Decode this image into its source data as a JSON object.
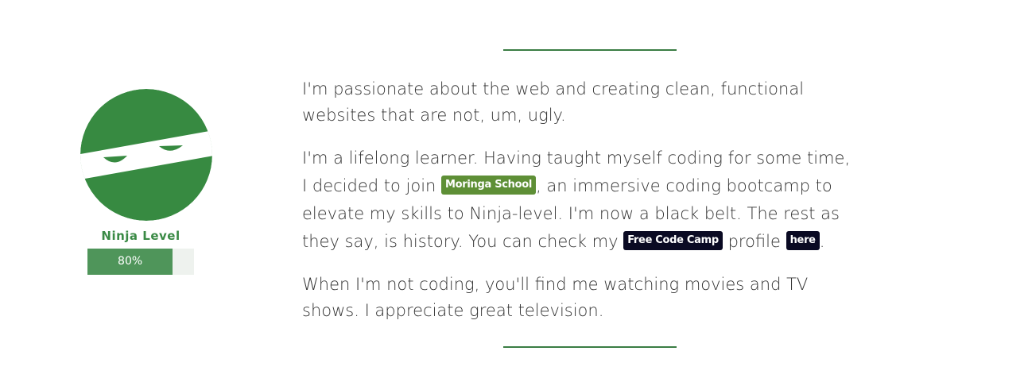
{
  "dividers": {
    "color": "#3a7d44"
  },
  "skill": {
    "icon": "ninja-icon",
    "label": "Ninja Level",
    "progress_text": "80%",
    "progress_value": 0.8,
    "color": "#3a8a45"
  },
  "about": {
    "p1": "I'm passionate about the web and creating clean, functional websites that are not, um, ugly.",
    "p2": {
      "before_school": "I'm a lifelong learner. Having taught myself coding for some time, I decided to join ",
      "school_link": "Moringa School",
      "after_school": ", an immersive coding bootcamp to elevate my skills to Ninja-level. I'm now a black belt. The rest as they say, is history. You can check my ",
      "fcc_link": "Free Code Camp",
      "middle": " profile ",
      "here_link": "here",
      "end": "."
    },
    "p3": "When I'm not coding, you'll find me watching movies and TV shows. I appreciate great television."
  }
}
